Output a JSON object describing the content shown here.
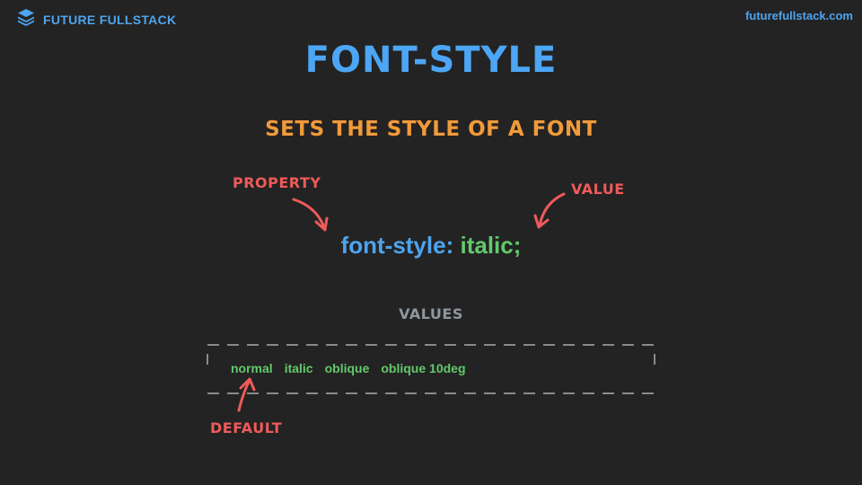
{
  "header": {
    "brand": "FUTURE FULLSTACK",
    "site_url": "futurefullstack.com",
    "logo_icon": "layers-stack-icon"
  },
  "slide": {
    "title": "FONT-STYLE",
    "subtitle": "SETS THE STYLE OF A FONT",
    "property_annotation": "PROPERTY",
    "value_annotation": "VALUE",
    "code_property": "font-style:",
    "code_value": "italic;",
    "values_label": "VALUES",
    "values": [
      "normal",
      "italic",
      "oblique",
      "oblique 10deg"
    ],
    "default_annotation": "DEFAULT"
  },
  "colors": {
    "background": "#232323",
    "blue": "#4ea4ee",
    "green": "#63c96b",
    "orange": "#f19a3a",
    "red": "#ef5a5a",
    "gray": "#8f969e"
  }
}
